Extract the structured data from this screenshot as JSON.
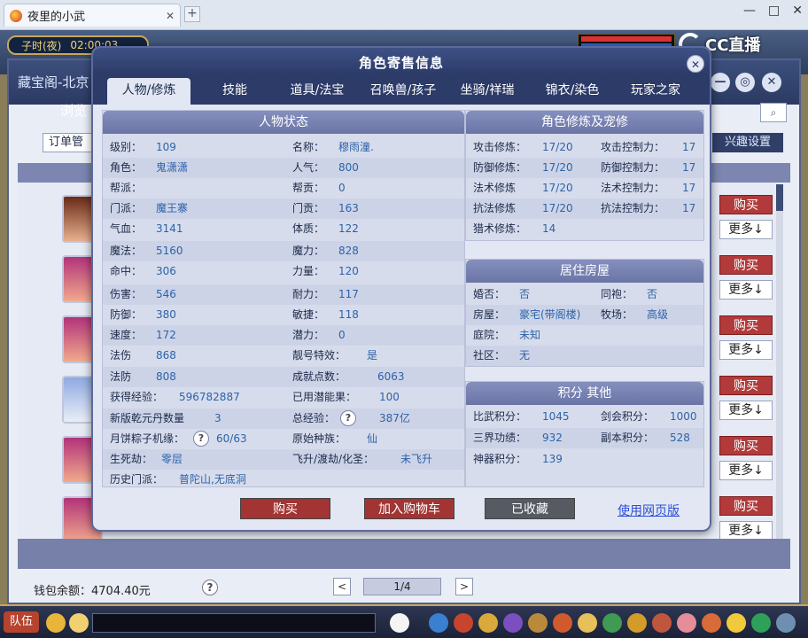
{
  "browser": {
    "tab_title": "夜里的小武",
    "close": "✕",
    "new_tab": "+",
    "window_controls": [
      "—",
      "□",
      "✕"
    ]
  },
  "game": {
    "time_label": "子时(夜)",
    "time_value": "02:00:03",
    "stream_logo": "CC直播",
    "team_button": "队伍"
  },
  "market": {
    "title": "藏宝阁-北京",
    "browse": "浏览",
    "order_management": "订单管",
    "interest_settings": "兴趣设置",
    "buy_label": "购买",
    "more_label": "更多↓",
    "wallet": "钱包余额：4704.40元",
    "help": "?",
    "pager": {
      "prev": "<",
      "current": "1/4",
      "next": ">"
    },
    "window_controls": [
      "—",
      "◎",
      "✕"
    ]
  },
  "modal": {
    "title": "角色寄售信息",
    "close": "✕",
    "tabs": [
      "人物/修炼",
      "技能",
      "道具/法宝",
      "召唤兽/孩子",
      "坐骑/祥瑞",
      "锦衣/染色",
      "玩家之家"
    ],
    "active_tab": 0,
    "status": {
      "heading": "人物状态",
      "left": [
        {
          "label": "级别：",
          "value": "109"
        },
        {
          "label": "角色：",
          "value": "鬼潇潇"
        },
        {
          "label": "帮派：",
          "value": ""
        },
        {
          "label": "门派：",
          "value": "魔王寨"
        },
        {
          "label": "气血：",
          "value": "3141"
        },
        {
          "label": "魔法：",
          "value": "5160"
        },
        {
          "label": "命中：",
          "value": "306"
        },
        {
          "label": "伤害：",
          "value": "546"
        },
        {
          "label": "防御：",
          "value": "380"
        },
        {
          "label": "速度：",
          "value": "172"
        },
        {
          "label": "法伤",
          "value": "868"
        },
        {
          "label": "法防",
          "value": "808"
        },
        {
          "label": "获得经验：",
          "value": "596782887"
        },
        {
          "label": "新版乾元丹数量",
          "value": "3"
        },
        {
          "label": "月饼粽子机缘：",
          "value": "60/63"
        },
        {
          "label": "生死劫：",
          "value": "零层"
        },
        {
          "label": "历史门派：",
          "value": "普陀山,无底洞"
        }
      ],
      "right": [
        {
          "label": "名称：",
          "value": "穆雨潼."
        },
        {
          "label": "人气：",
          "value": "800"
        },
        {
          "label": "帮贡：",
          "value": "0"
        },
        {
          "label": "门贡：",
          "value": "163"
        },
        {
          "label": "体质：",
          "value": "122"
        },
        {
          "label": "魔力：",
          "value": "828"
        },
        {
          "label": "力量：",
          "value": "120"
        },
        {
          "label": "耐力：",
          "value": "117"
        },
        {
          "label": "敏捷：",
          "value": "118"
        },
        {
          "label": "潜力：",
          "value": "0"
        },
        {
          "label": "靓号特效：",
          "value": "是"
        },
        {
          "label": "成就点数：",
          "value": "6063"
        },
        {
          "label": "已用潜能果：",
          "value": "100"
        },
        {
          "label": "总经验：",
          "value": "387亿"
        },
        {
          "label": "原始种族：",
          "value": "仙"
        },
        {
          "label": "飞升/渡劫/化圣：",
          "value": "未飞升"
        }
      ]
    },
    "cultivation": {
      "heading": "角色修炼及宠修",
      "rows": [
        {
          "l1": "攻击修炼：",
          "v1": "17/20",
          "l2": "攻击控制力：",
          "v2": "17"
        },
        {
          "l1": "防御修炼：",
          "v1": "17/20",
          "l2": "防御控制力：",
          "v2": "17"
        },
        {
          "l1": "法术修炼",
          "v1": "17/20",
          "l2": "法术控制力：",
          "v2": "17"
        },
        {
          "l1": "抗法修炼",
          "v1": "17/20",
          "l2": "抗法控制力：",
          "v2": "17"
        },
        {
          "l1": "猎术修炼：",
          "v1": "14",
          "l2": "",
          "v2": ""
        }
      ]
    },
    "housing": {
      "heading": "居住房屋",
      "rows": [
        {
          "l1": "婚否：",
          "v1": "否",
          "l2": "同袍：",
          "v2": "否"
        },
        {
          "l1": "房屋：",
          "v1": "豪宅(带阁楼)",
          "l2": "牧场：",
          "v2": "高级"
        },
        {
          "l1": "庭院：",
          "v1": "未知",
          "l2": "",
          "v2": ""
        },
        {
          "l1": "社区：",
          "v1": "无",
          "l2": "",
          "v2": ""
        }
      ]
    },
    "points": {
      "heading": "积分 其他",
      "rows": [
        {
          "l1": "比武积分：",
          "v1": "1045",
          "l2": "剑会积分：",
          "v2": "1000"
        },
        {
          "l1": "三界功绩：",
          "v1": "932",
          "l2": "副本积分：",
          "v2": "528"
        },
        {
          "l1": "神器积分：",
          "v1": "139",
          "l2": "",
          "v2": ""
        }
      ]
    },
    "actions": {
      "buy": "购买",
      "add_cart": "加入购物车",
      "favorited": "已收藏",
      "web_version": "使用网页版"
    },
    "help": "?"
  },
  "colors": {
    "value_blue": "#2c63a8",
    "header_navy": "#2c3b68",
    "buy_red": "#a33434",
    "link_blue": "#2b4fd6"
  }
}
